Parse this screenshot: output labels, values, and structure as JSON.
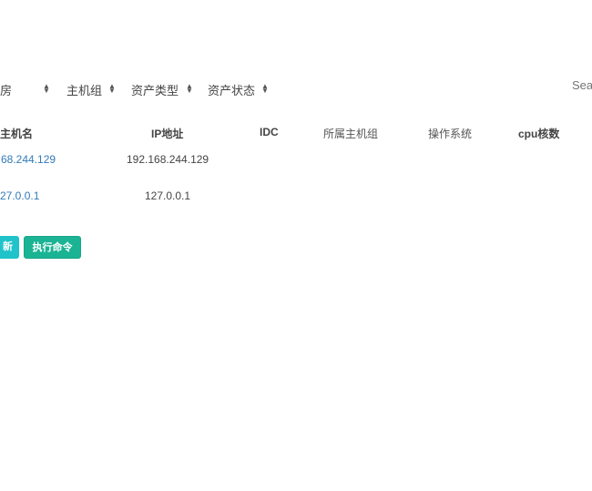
{
  "filters": [
    {
      "label": "房"
    },
    {
      "label": "主机组"
    },
    {
      "label": "资产类型"
    },
    {
      "label": "资产状态"
    }
  ],
  "search": {
    "placeholder": "Sea"
  },
  "table": {
    "headers": [
      "主机名",
      "IP地址",
      "IDC",
      "所属主机组",
      "操作系统",
      "cpu核数"
    ],
    "rows": [
      {
        "hostname": "68.244.129",
        "ip": "192.168.244.129"
      },
      {
        "hostname": "27.0.0.1",
        "ip": "127.0.0.1"
      }
    ]
  },
  "buttons": {
    "update": "新",
    "exec": "执行命令"
  },
  "colors": {
    "update": "#1fc3c9",
    "exec": "#1ab394",
    "link": "#337ab7"
  }
}
